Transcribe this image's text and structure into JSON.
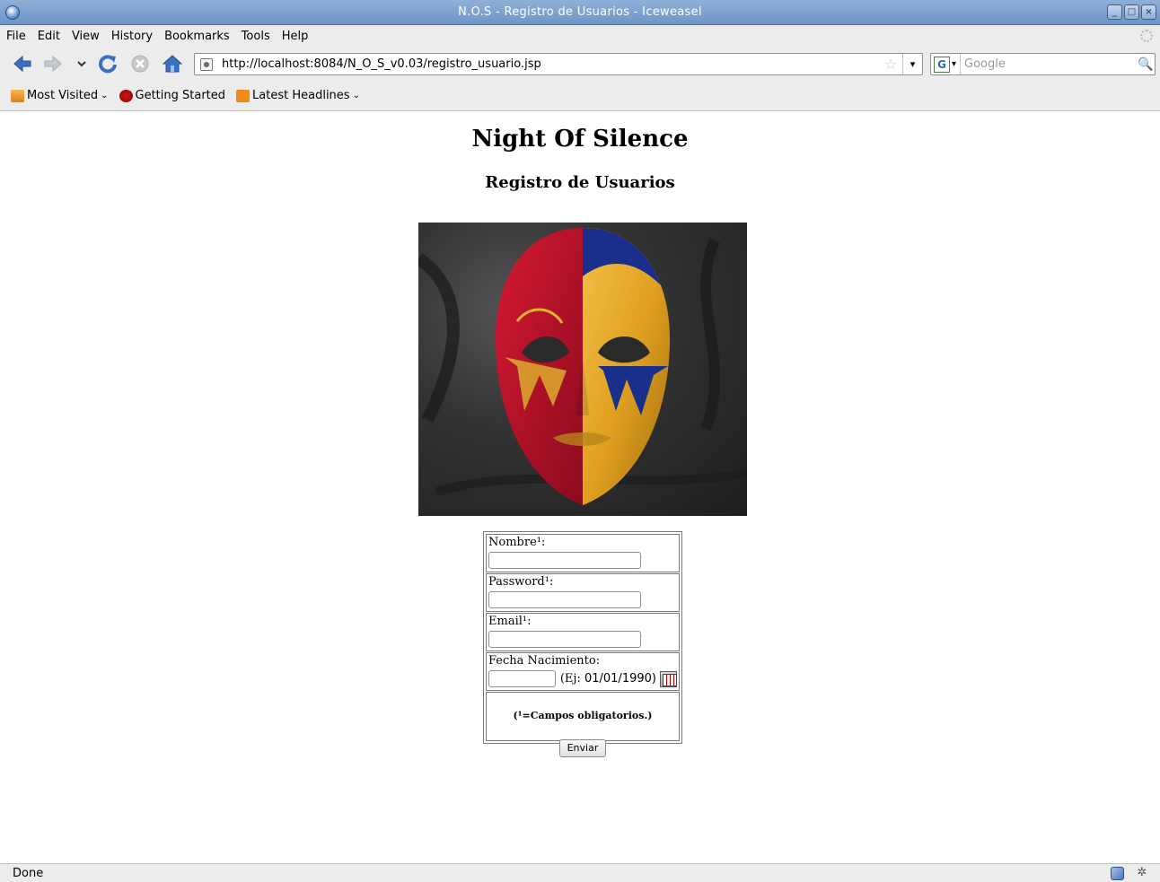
{
  "window": {
    "title": "N.O.S - Registro de Usuarios - Iceweasel",
    "controls": [
      "_",
      "□",
      "×"
    ]
  },
  "menubar": {
    "items": [
      "File",
      "Edit",
      "View",
      "History",
      "Bookmarks",
      "Tools",
      "Help"
    ]
  },
  "toolbar": {
    "url": "http://localhost:8084/N_O_S_v0.03/registro_usuario.jsp",
    "search_placeholder": "Google",
    "search_engine_letter": "G",
    "icons": [
      "back-arrow-icon",
      "forward-arrow-icon",
      "history-dropdown-icon",
      "reload-icon",
      "stop-icon",
      "home-icon"
    ]
  },
  "bookmarks": {
    "items": [
      {
        "label": "Most Visited",
        "icon": "folder-icon",
        "has_menu": true
      },
      {
        "label": "Getting Started",
        "icon": "bug-icon",
        "has_menu": false
      },
      {
        "label": "Latest Headlines",
        "icon": "rss-icon",
        "has_menu": true
      }
    ]
  },
  "page": {
    "title": "Night Of Silence",
    "subtitle": "Registro de Usuarios",
    "image_subject": "half red, half gold masquerade mask",
    "form": {
      "nombre_label": "Nombre¹:",
      "password_label": "Password¹:",
      "email_label": "Email¹:",
      "fecha_label": "Fecha Nacimiento:",
      "fecha_example_prefix": "(Ej: ",
      "fecha_example_value": "01/01/1990)",
      "note": "(¹=Campos obligatorios.)",
      "submit_label": "Enviar",
      "nombre_value": "",
      "password_value": "",
      "email_value": "",
      "fecha_value": ""
    }
  },
  "statusbar": {
    "text": "Done"
  },
  "colors": {
    "titlebar": "#7ea2d0",
    "chrome": "#ececec",
    "mask_red": "#c8102e",
    "mask_gold": "#e0a020",
    "mask_blue": "#1a2f8c"
  }
}
